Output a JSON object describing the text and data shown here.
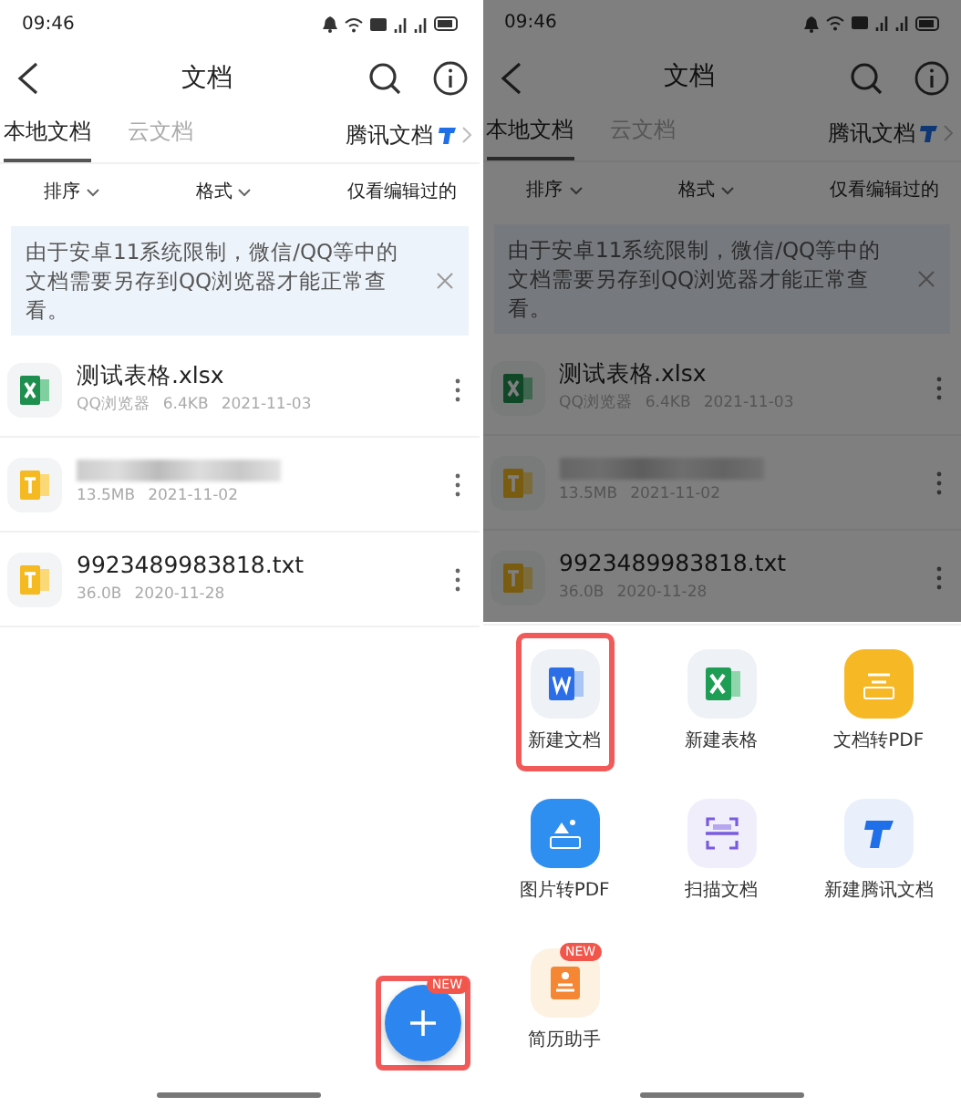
{
  "screens": [
    {
      "dimmed": false,
      "status_bar": {
        "time": "09:46"
      },
      "title": "文档",
      "tabs": [
        {
          "label": "本地文档",
          "selected": true
        },
        {
          "label": "云文档",
          "selected": false
        }
      ],
      "tencent_link": "腾讯文档",
      "filters": [
        "排序",
        "格式"
      ],
      "edited_filter": "仅看编辑过的",
      "notice": "由于安卓11系统限制，微信/QQ等中的文档需要另存到QQ浏览器才能正常查看。",
      "files": [
        {
          "kind": "xlsx",
          "blurred": false,
          "name": "测试表格.xlsx",
          "meta": [
            "QQ浏览器",
            "6.4KB",
            "2021-11-03"
          ]
        },
        {
          "kind": "txt",
          "blurred": true,
          "meta": [
            "13.5MB",
            "2021-11-02"
          ]
        },
        {
          "kind": "txt",
          "blurred": false,
          "name": "9923489983818.txt",
          "meta": [
            "36.0B",
            "2020-11-28"
          ]
        }
      ],
      "fab": {
        "badge": "NEW",
        "highlighted": true
      }
    },
    {
      "dimmed": true,
      "status_bar": {
        "time": "09:46"
      },
      "title": "文档",
      "tabs": [
        {
          "label": "本地文档",
          "selected": true
        },
        {
          "label": "云文档",
          "selected": false
        }
      ],
      "tencent_link": "腾讯文档",
      "filters": [
        "排序",
        "格式"
      ],
      "edited_filter": "仅看编辑过的",
      "notice": "由于安卓11系统限制，微信/QQ等中的文档需要另存到QQ浏览器才能正常查看。",
      "files": [
        {
          "kind": "xlsx",
          "blurred": false,
          "name": "测试表格.xlsx",
          "meta": [
            "QQ浏览器",
            "6.4KB",
            "2021-11-03"
          ]
        },
        {
          "kind": "txt",
          "blurred": true,
          "meta": [
            "13.5MB",
            "2021-11-02"
          ]
        },
        {
          "kind": "txt",
          "blurred": false,
          "name": "9923489983818.txt",
          "meta": [
            "36.0B",
            "2020-11-28"
          ]
        }
      ],
      "sheet": {
        "actions": [
          {
            "kind": "word",
            "label": "新建文档",
            "highlighted": true
          },
          {
            "kind": "excel",
            "label": "新建表格",
            "highlighted": false
          },
          {
            "kind": "pdf-doc",
            "label": "文档转PDF",
            "highlighted": false
          },
          {
            "kind": "pdf-image",
            "label": "图片转PDF",
            "highlighted": false
          },
          {
            "kind": "scan",
            "label": "扫描文档",
            "highlighted": false
          },
          {
            "kind": "tencent",
            "label": "新建腾讯文档",
            "highlighted": false
          },
          {
            "kind": "resume",
            "label": "简历助手",
            "highlighted": false,
            "badge": "NEW"
          }
        ]
      }
    }
  ]
}
